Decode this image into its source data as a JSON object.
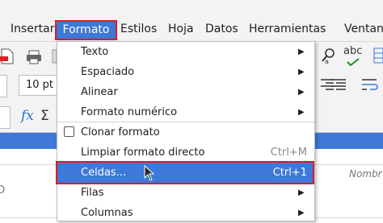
{
  "menubar": {
    "items": [
      "Insertar",
      "Formato",
      "Estilos",
      "Hoja",
      "Datos",
      "Herramientas",
      "Ventana"
    ],
    "active": "Formato"
  },
  "toolbar": {
    "font_size": "10 pt",
    "spellcheck_label": "abc",
    "function_label": "fx",
    "sum_label": "Σ"
  },
  "sheet": {
    "cell_right_text": "Nombr",
    "cell_left_char": "O"
  },
  "format_menu": {
    "items": [
      {
        "label": "Texto",
        "submenu": true
      },
      {
        "label": "Espaciado",
        "submenu": true
      },
      {
        "label": "Alinear",
        "submenu": true
      },
      {
        "label": "Formato numérico",
        "submenu": true
      },
      {
        "label": "Clonar formato",
        "checkbox": true
      },
      {
        "label": "Limpiar formato directo",
        "shortcut": "Ctrl+M"
      },
      {
        "label": "Celdas...",
        "shortcut": "Ctrl+1",
        "selected": true
      },
      {
        "label": "Filas",
        "submenu": true
      },
      {
        "label": "Columnas",
        "submenu": true
      }
    ]
  },
  "colors": {
    "accent": "#3c79d8",
    "highlight_outline": "#e01b24"
  }
}
